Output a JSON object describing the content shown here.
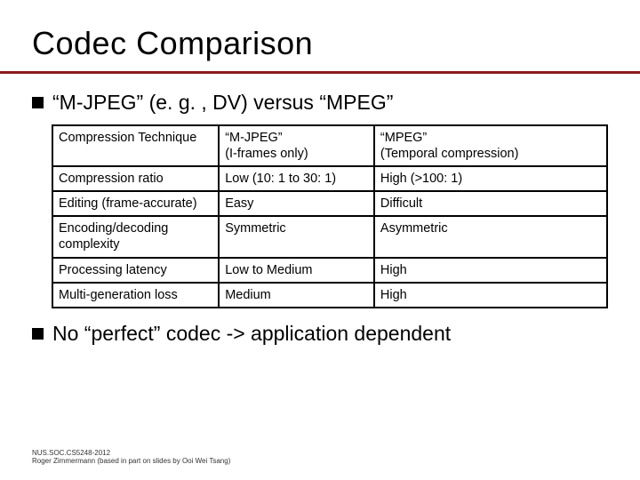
{
  "title": "Codec Comparison",
  "bullets": {
    "b1": "“M-JPEG” (e. g. , DV) versus “MPEG”",
    "b2": "No “perfect” codec -> application dependent"
  },
  "table": {
    "headers": {
      "c0": "Compression Technique",
      "c1a": "“M-JPEG”",
      "c1b": "(I-frames only)",
      "c2a": "“MPEG”",
      "c2b": "(Temporal compression)"
    },
    "rows": [
      {
        "c0": "Compression ratio",
        "c1": "Low (10: 1 to 30: 1)",
        "c2": "High (>100: 1)"
      },
      {
        "c0": "Editing (frame-accurate)",
        "c1": "Easy",
        "c2": "Difficult"
      },
      {
        "c0": "Encoding/decoding complexity",
        "c1": "Symmetric",
        "c2": "Asymmetric"
      },
      {
        "c0": "Processing latency",
        "c1": "Low to Medium",
        "c2": "High"
      },
      {
        "c0": "Multi-generation loss",
        "c1": "Medium",
        "c2": "High"
      }
    ]
  },
  "footer": {
    "line1": "NUS.SOC.CS5248-2012",
    "line2": "Roger Zimmermann (based in part on slides by Ooi Wei Tsang)"
  }
}
